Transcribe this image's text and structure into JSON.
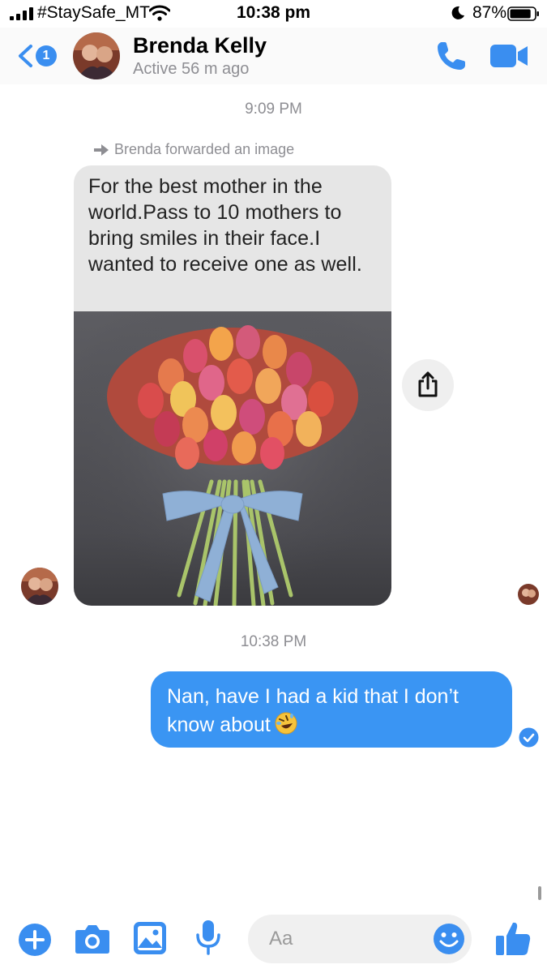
{
  "status_bar": {
    "carrier": "#StaySafe_MT",
    "time": "10:38 pm",
    "battery_percent": "87%",
    "battery_level": 0.87,
    "icons": [
      "signal-bars-icon",
      "wifi-icon",
      "moon-icon",
      "battery-icon"
    ]
  },
  "header": {
    "back_badge": "1",
    "contact_name": "Brenda Kelly",
    "contact_status": "Active 56 m ago",
    "icons": [
      "back-chevron-icon",
      "phone-icon",
      "video-camera-icon"
    ]
  },
  "conversation": {
    "timestamp_1": "9:09 PM",
    "forward_note": "Brenda forwarded an image",
    "image_caption": "For the best mother in the world.Pass to 10 mothers to bring smiles in their face.I wanted to receive one as well.",
    "timestamp_2": "10:38 PM",
    "outgoing_message": "Nan, have I had a kid that I don’t know about",
    "outgoing_emoji": "🤣"
  },
  "composer": {
    "placeholder": "Aa",
    "icons": [
      "plus-icon",
      "camera-icon",
      "image-icon",
      "microphone-icon",
      "smiley-icon",
      "thumbs-up-icon"
    ]
  },
  "colors": {
    "accent": "#3a8ef0",
    "bubble_outgoing": "#3a95f3",
    "secondary_text": "#8e8e93"
  }
}
